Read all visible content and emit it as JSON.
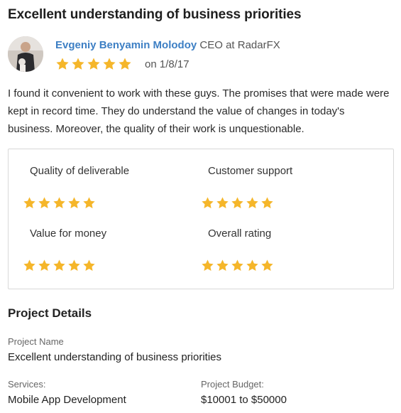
{
  "review": {
    "title": "Excellent understanding of business priorities",
    "reviewer": {
      "name": "Evgeniy Benyamin Molodoy",
      "role": "CEO at RadarFX"
    },
    "rating_stars": 5,
    "date": "on 1/8/17",
    "text": "I found it convenient to work with these guys. The promises that were made were kept in record time. They do understand the value of changes in today's business. Moreover, the quality of their work is unquestionable."
  },
  "ratings": [
    {
      "label": "Quality of deliverable",
      "stars": 5
    },
    {
      "label": "Customer support",
      "stars": 5
    },
    {
      "label": "Value for money",
      "stars": 5
    },
    {
      "label": "Overall rating",
      "stars": 5
    }
  ],
  "project": {
    "section_title": "Project Details",
    "name_label": "Project Name",
    "name_value": "Excellent understanding of business priorities",
    "services_label": "Services:",
    "services_value": "Mobile App Development",
    "budget_label": "Project Budget:",
    "budget_value": "$10001 to $50000"
  },
  "colors": {
    "star": "#f5b62a",
    "name_link": "#3d7fc4"
  },
  "icons": {
    "star": "star-icon",
    "avatar": "user-photo"
  }
}
